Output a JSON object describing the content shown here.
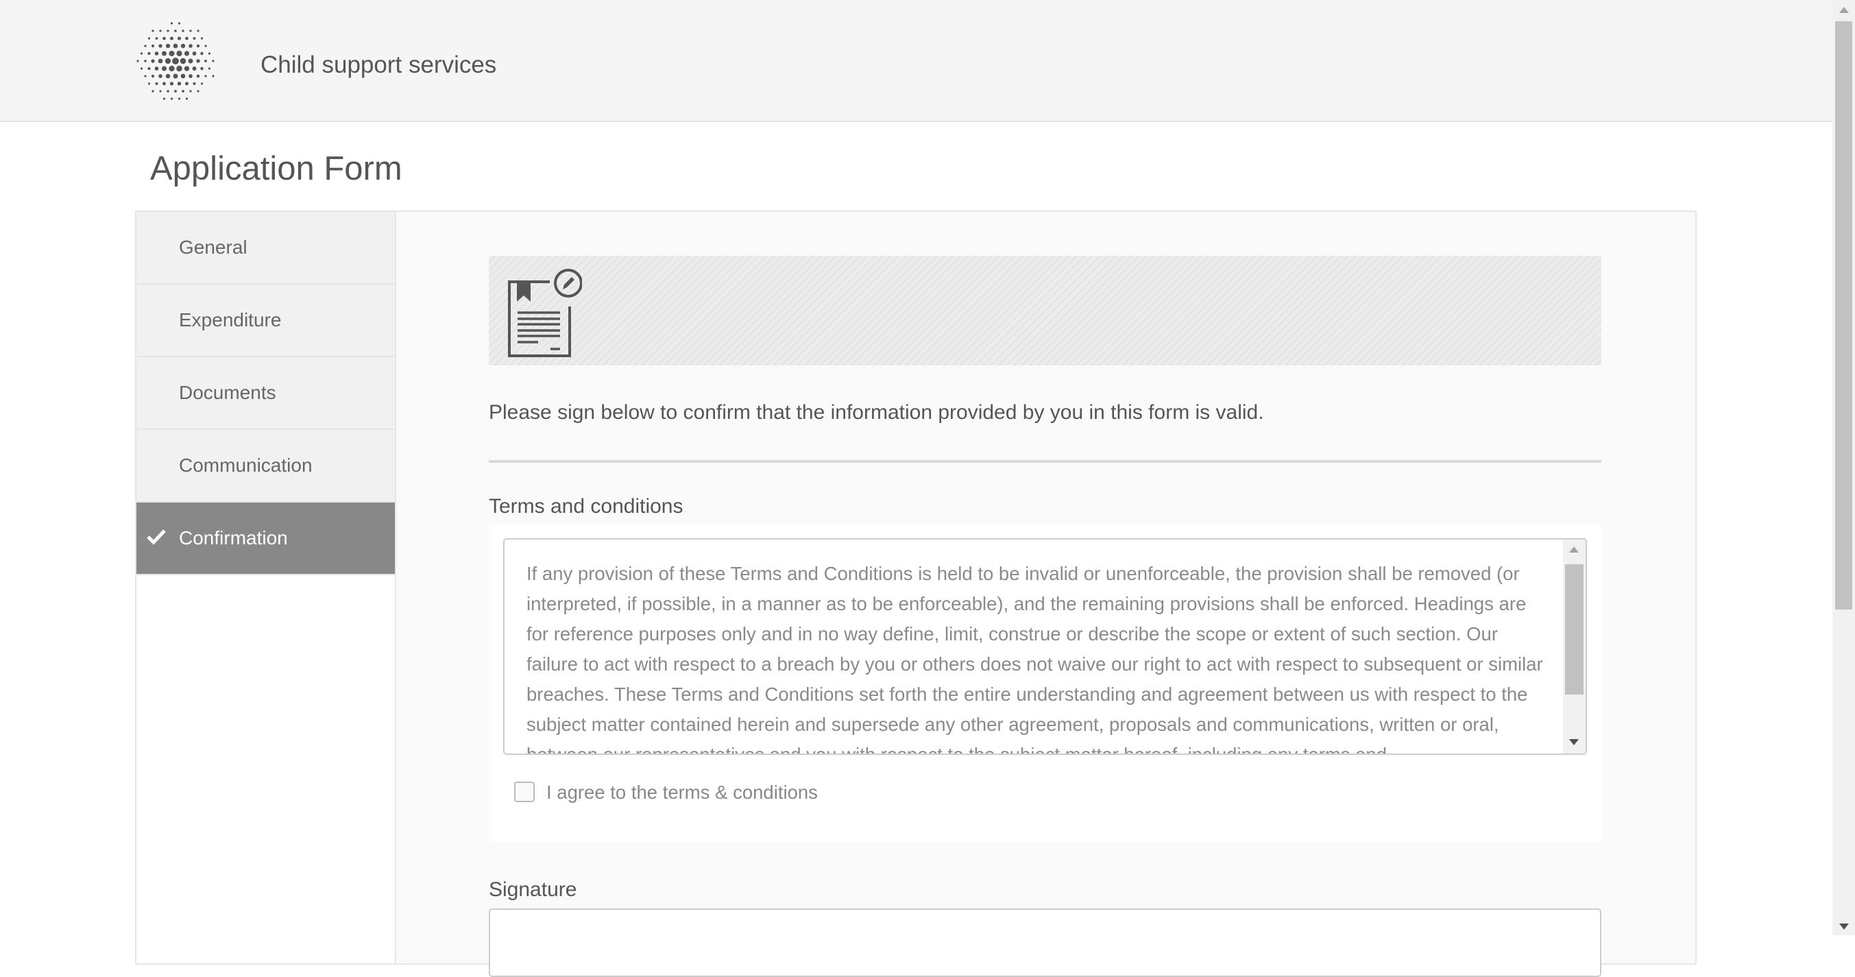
{
  "header": {
    "title": "Child support services",
    "logo_icon": "dotted-sphere-logo"
  },
  "page": {
    "title": "Application Form"
  },
  "sidebar": {
    "items": [
      {
        "label": "General",
        "active": false
      },
      {
        "label": "Expenditure",
        "active": false
      },
      {
        "label": "Documents",
        "active": false
      },
      {
        "label": "Communication",
        "active": false
      },
      {
        "label": "Confirmation",
        "active": true,
        "icon": "check-icon"
      }
    ]
  },
  "main": {
    "banner_icon": "document-sign-icon",
    "instruction": "Please sign below to confirm that the information provided by you in this form is valid.",
    "terms_label": "Terms and conditions",
    "terms_text": "If any provision of these Terms and Conditions is held to be invalid or unenforceable, the provision shall be removed (or interpreted, if possible, in a manner as to be enforceable), and the remaining provisions shall be enforced. Headings are for reference purposes only and in no way define, limit, construe or describe the scope or extent of such section. Our failure to act with respect to a breach by you or others does not waive our right to act with respect to subsequent or similar breaches. These Terms and Conditions set forth the entire understanding and agreement between us with respect to the subject matter contained herein and supersede any other agreement, proposals and communications, written or oral, between our representatives and you with respect to the subject matter hereof, including any terms and",
    "agree_label": "I agree to the terms & conditions",
    "agree_checked": false,
    "signature_label": "Signature"
  },
  "colors": {
    "active_nav": "#888888",
    "header_bg": "#f5f5f5"
  }
}
